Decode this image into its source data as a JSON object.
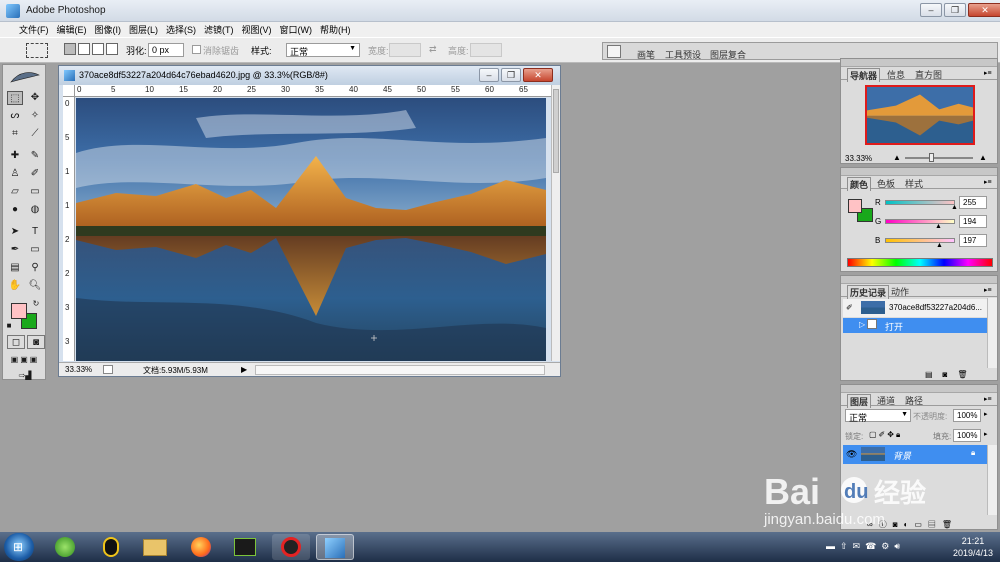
{
  "app": {
    "title": "Adobe Photoshop"
  },
  "menu": [
    "文件(F)",
    "编辑(E)",
    "图像(I)",
    "图层(L)",
    "选择(S)",
    "滤镜(T)",
    "视图(V)",
    "窗口(W)",
    "帮助(H)"
  ],
  "options": {
    "feather_label": "羽化:",
    "feather_value": "0 px",
    "antialias_label": "消除锯齿",
    "style_label": "样式:",
    "style_value": "正常",
    "width_label": "宽度:",
    "height_label": "高度:"
  },
  "dock_tabs": [
    "画笔",
    "工具预设",
    "图层复合"
  ],
  "document": {
    "title": "370ace8df53227a204d64c76ebad4620.jpg @ 33.3%(RGB/8#)",
    "zoom": "33.33%",
    "doc_size": "文档:5.93M/5.93M",
    "ruler_h": [
      "0",
      "5",
      "10",
      "15",
      "20",
      "25",
      "30",
      "35",
      "40",
      "45",
      "50",
      "55",
      "60",
      "65"
    ],
    "ruler_v": [
      "0",
      "5",
      "1",
      "1",
      "2",
      "2",
      "3",
      "3"
    ]
  },
  "navigator": {
    "tabs": [
      "导航器",
      "信息",
      "直方图"
    ],
    "zoom": "33.33%"
  },
  "color": {
    "tabs": [
      "颜色",
      "色板",
      "样式"
    ],
    "channels": [
      {
        "label": "R",
        "value": "255",
        "level": 1.0,
        "gradient": "linear-gradient(90deg,#00c2c5,#ffc2c5)"
      },
      {
        "label": "G",
        "value": "194",
        "level": 0.76,
        "gradient": "linear-gradient(90deg,#ff00c5,#ffffc5)"
      },
      {
        "label": "B",
        "value": "197",
        "level": 0.77,
        "gradient": "linear-gradient(90deg,#ffc200,#ffc2ff)"
      }
    ],
    "fg": "#ffc2c5",
    "bg": "#19a81b"
  },
  "history": {
    "tabs": [
      "历史记录",
      "动作"
    ],
    "snapshot": "370ace8df53227a204d6...",
    "items": [
      "打开"
    ]
  },
  "layers": {
    "tabs": [
      "图层",
      "通道",
      "路径"
    ],
    "blend": "正常",
    "opacity_label": "不透明度:",
    "opacity_value": "100%",
    "lock_label": "锁定:",
    "fill_label": "填充:",
    "fill_value": "100%",
    "items": [
      "背景"
    ]
  },
  "taskbar": {
    "time": "21:21",
    "date": "2019/4/13"
  },
  "watermark": {
    "text": "Bai du 经验",
    "url": "jingyan.baidu.com"
  }
}
